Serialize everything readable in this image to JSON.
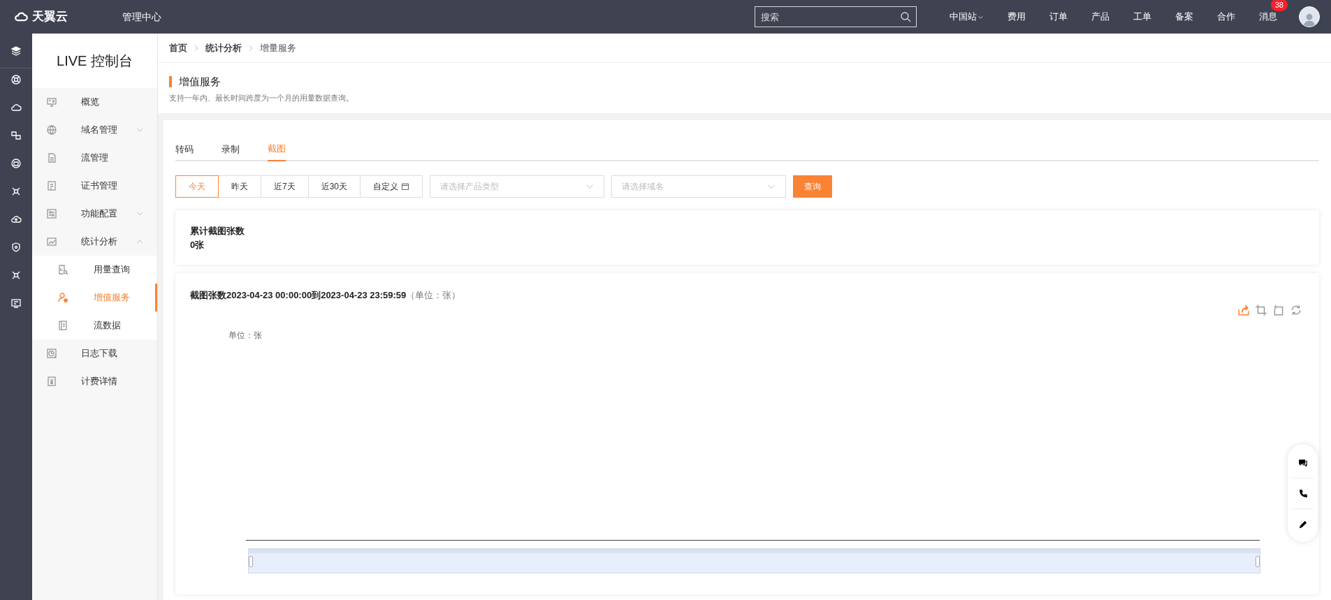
{
  "topbar": {
    "logo_text": "天翼云",
    "title": "管理中心",
    "search": {
      "placeholder": "搜索"
    },
    "nav": [
      {
        "label": "中国站",
        "dropdown": true
      },
      {
        "label": "费用",
        "dropdown": false
      },
      {
        "label": "订单",
        "dropdown": false
      },
      {
        "label": "产品",
        "dropdown": false
      },
      {
        "label": "工单",
        "dropdown": false
      },
      {
        "label": "备案",
        "dropdown": false
      },
      {
        "label": "合作",
        "dropdown": false
      },
      {
        "label": "消息",
        "dropdown": false,
        "badge": "38"
      }
    ]
  },
  "sidebar": {
    "title": "LIVE 控制台",
    "items": [
      {
        "label": "概览"
      },
      {
        "label": "域名管理",
        "expanded": false
      },
      {
        "label": "流管理"
      },
      {
        "label": "证书管理"
      },
      {
        "label": "功能配置",
        "expanded": false
      },
      {
        "label": "统计分析",
        "expanded": true,
        "children": [
          {
            "label": "用量查询",
            "selected": false
          },
          {
            "label": "增值服务",
            "selected": true
          },
          {
            "label": "流数据",
            "selected": false
          }
        ]
      },
      {
        "label": "日志下载"
      },
      {
        "label": "计费详情"
      }
    ]
  },
  "breadcrumb": [
    "首页",
    "统计分析",
    "增量服务"
  ],
  "page": {
    "title": "增值服务",
    "subtitle": "支持一年内、最长时间跨度为一个月的用量数据查询。"
  },
  "tabs": [
    {
      "label": "转码",
      "selected": false
    },
    {
      "label": "录制",
      "selected": false
    },
    {
      "label": "截图",
      "selected": true
    }
  ],
  "filters": {
    "ranges": [
      {
        "label": "今天",
        "selected": true,
        "calendar": false
      },
      {
        "label": "昨天",
        "selected": false,
        "calendar": false
      },
      {
        "label": "近7天",
        "selected": false,
        "calendar": false
      },
      {
        "label": "近30天",
        "selected": false,
        "calendar": false
      },
      {
        "label": "自定义",
        "selected": false,
        "calendar": true
      }
    ],
    "selects": [
      {
        "placeholder": "请选择产品类型"
      },
      {
        "placeholder": "请选择域名"
      }
    ],
    "query_button": "查询"
  },
  "summary": {
    "label": "累计截图张数",
    "value": "0张"
  },
  "chart_card": {
    "title": "截图张数2023-04-23 00:00:00到2023-04-23 23:59:59",
    "title_suffix": "（单位：张）",
    "unit_label": "单位：张",
    "tools": [
      {
        "active": true
      },
      {
        "active": false
      },
      {
        "active": false
      },
      {
        "active": false
      }
    ]
  }
}
